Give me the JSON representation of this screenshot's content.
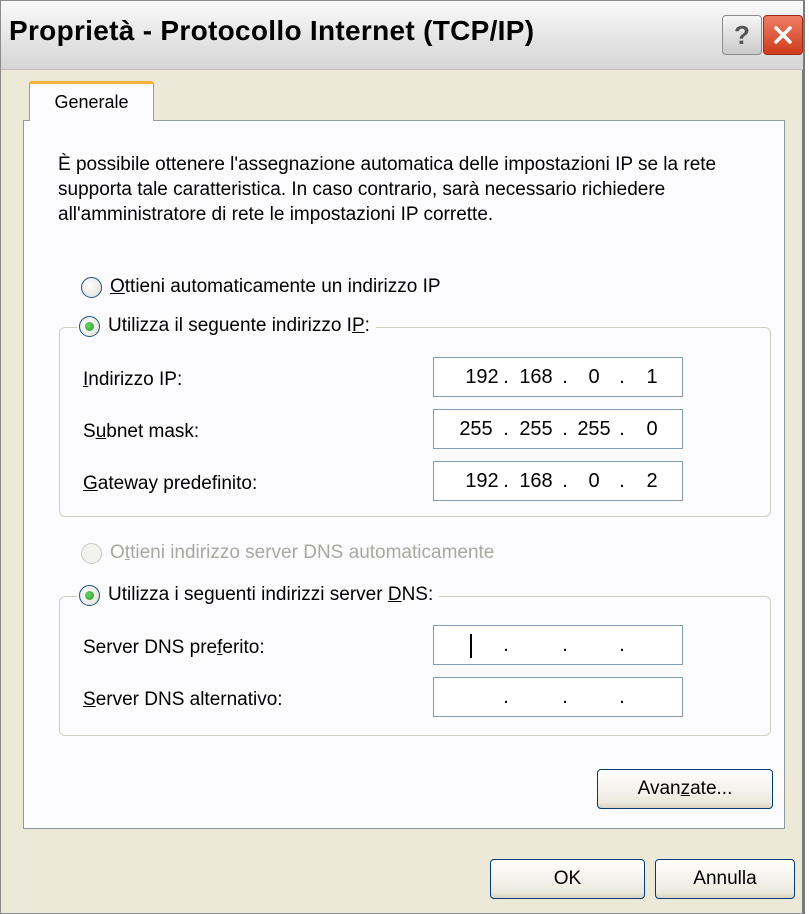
{
  "window": {
    "title": "Proprietà - Protocollo Internet (TCP/IP)",
    "help_label": "?",
    "close_label": "✕"
  },
  "tabs": [
    {
      "label": "Generale",
      "selected": true
    }
  ],
  "description": "È possibile ottenere l'assegnazione automatica delle impostazioni IP se la rete supporta tale caratteristica. In caso contrario, sarà necessario richiedere all'amministratore di rete le impostazioni IP corrette.",
  "ip_section": {
    "auto_option": {
      "access_key": "O",
      "rest": "ttieni automaticamente un indirizzo IP",
      "selected": false
    },
    "manual_option": {
      "before": "Utilizza il seguente indirizzo I",
      "access_key": "P",
      "after": ":",
      "selected": true
    },
    "fields": [
      {
        "key": "ip",
        "access_key": "I",
        "rest": "ndirizzo IP:",
        "octets": [
          "192",
          "168",
          "0",
          "1"
        ]
      },
      {
        "key": "subnet",
        "before": "S",
        "access_key": "u",
        "after": "bnet mask:",
        "octets": [
          "255",
          "255",
          "255",
          "0"
        ]
      },
      {
        "key": "gateway",
        "access_key": "G",
        "rest": "ateway predefinito:",
        "octets": [
          "192",
          "168",
          "0",
          "2"
        ]
      }
    ]
  },
  "dns_section": {
    "auto_option": {
      "before": "O",
      "access_key": "t",
      "after": "tieni indirizzo server DNS automaticamente",
      "selected": false,
      "enabled": false
    },
    "manual_option": {
      "before": "Utilizza i seguenti indirizzi server ",
      "access_key": "D",
      "after": "NS:",
      "selected": true
    },
    "fields": [
      {
        "key": "preferred",
        "before": "Server DNS pre",
        "access_key": "f",
        "after": "erito:",
        "octets": [
          "",
          "",
          "",
          ""
        ],
        "focused": true
      },
      {
        "key": "alternate",
        "access_key": "S",
        "rest": "erver DNS alternativo:",
        "octets": [
          "",
          "",
          "",
          ""
        ]
      }
    ]
  },
  "ip_separator": ".",
  "buttons": {
    "advanced": {
      "before": "Avan",
      "access_key": "z",
      "after": "ate..."
    },
    "ok": "OK",
    "cancel": "Annulla"
  }
}
